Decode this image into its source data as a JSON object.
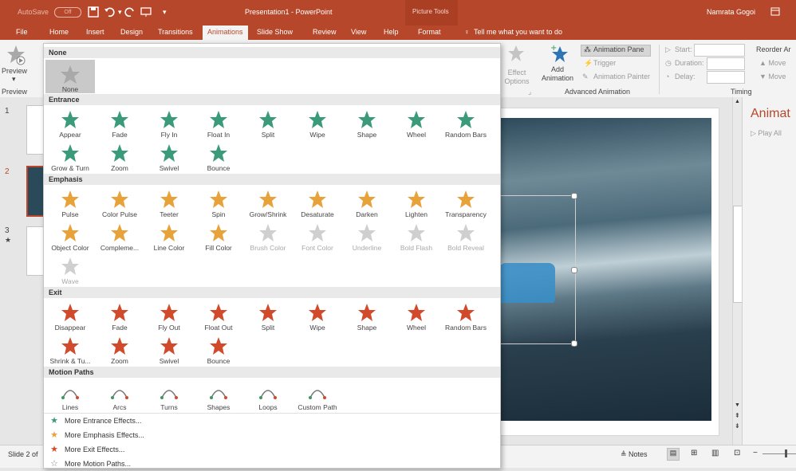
{
  "titlebar": {
    "autosave": "AutoSave",
    "autosave_state": "Off",
    "doc_title": "Presentation1 - PowerPoint",
    "context_tab_group": "Picture Tools",
    "user": "Namrata Gogoi"
  },
  "tabs": [
    "File",
    "Home",
    "Insert",
    "Design",
    "Transitions",
    "Animations",
    "Slide Show",
    "Review",
    "View",
    "Help",
    "Format"
  ],
  "active_tab": "Animations",
  "tell_me": "Tell me what you want to do",
  "ribbon": {
    "preview": "Preview",
    "preview_group": "Preview",
    "effect_options": "Effect Options",
    "add_animation": "Add Animation",
    "animation_pane": "Animation Pane",
    "trigger": "Trigger",
    "animation_painter": "Animation Painter",
    "advanced_group": "Advanced Animation",
    "start": "Start:",
    "duration": "Duration:",
    "delay": "Delay:",
    "reorder": "Reorder Ar",
    "move_earlier": "Move",
    "move_later": "Move",
    "timing_group": "Timing"
  },
  "slides": [
    "1",
    "2",
    "3"
  ],
  "gallery": {
    "none_header": "None",
    "none_item": "None",
    "sections": {
      "entrance": {
        "title": "Entrance",
        "items": [
          "Appear",
          "Fade",
          "Fly In",
          "Float In",
          "Split",
          "Wipe",
          "Shape",
          "Wheel",
          "Random Bars",
          "Grow & Turn",
          "Zoom",
          "Swivel",
          "Bounce"
        ]
      },
      "emphasis": {
        "title": "Emphasis",
        "items": [
          "Pulse",
          "Color Pulse",
          "Teeter",
          "Spin",
          "Grow/Shrink",
          "Desaturate",
          "Darken",
          "Lighten",
          "Transparency",
          "Object Color",
          "Compleme...",
          "Line Color",
          "Fill Color",
          "Brush Color",
          "Font Color",
          "Underline",
          "Bold Flash",
          "Bold Reveal",
          "Wave"
        ]
      },
      "exit": {
        "title": "Exit",
        "items": [
          "Disappear",
          "Fade",
          "Fly Out",
          "Float Out",
          "Split",
          "Wipe",
          "Shape",
          "Wheel",
          "Random Bars",
          "Shrink & Tu...",
          "Zoom",
          "Swivel",
          "Bounce"
        ]
      },
      "motion": {
        "title": "Motion Paths",
        "items": [
          "Lines",
          "Arcs",
          "Turns",
          "Shapes",
          "Loops",
          "Custom Path"
        ]
      }
    },
    "more": [
      "More Entrance Effects...",
      "More Emphasis Effects...",
      "More Exit Effects...",
      "More Motion Paths..."
    ]
  },
  "anim_pane": {
    "title": "Animat",
    "play_all": "Play All"
  },
  "statusbar": {
    "slide_info": "Slide 2 of",
    "notes": "Notes"
  },
  "colors": {
    "accent": "#b7472a",
    "entrance": "#3a9a7a",
    "emphasis": "#e8a23a",
    "exit": "#d14a2c"
  }
}
